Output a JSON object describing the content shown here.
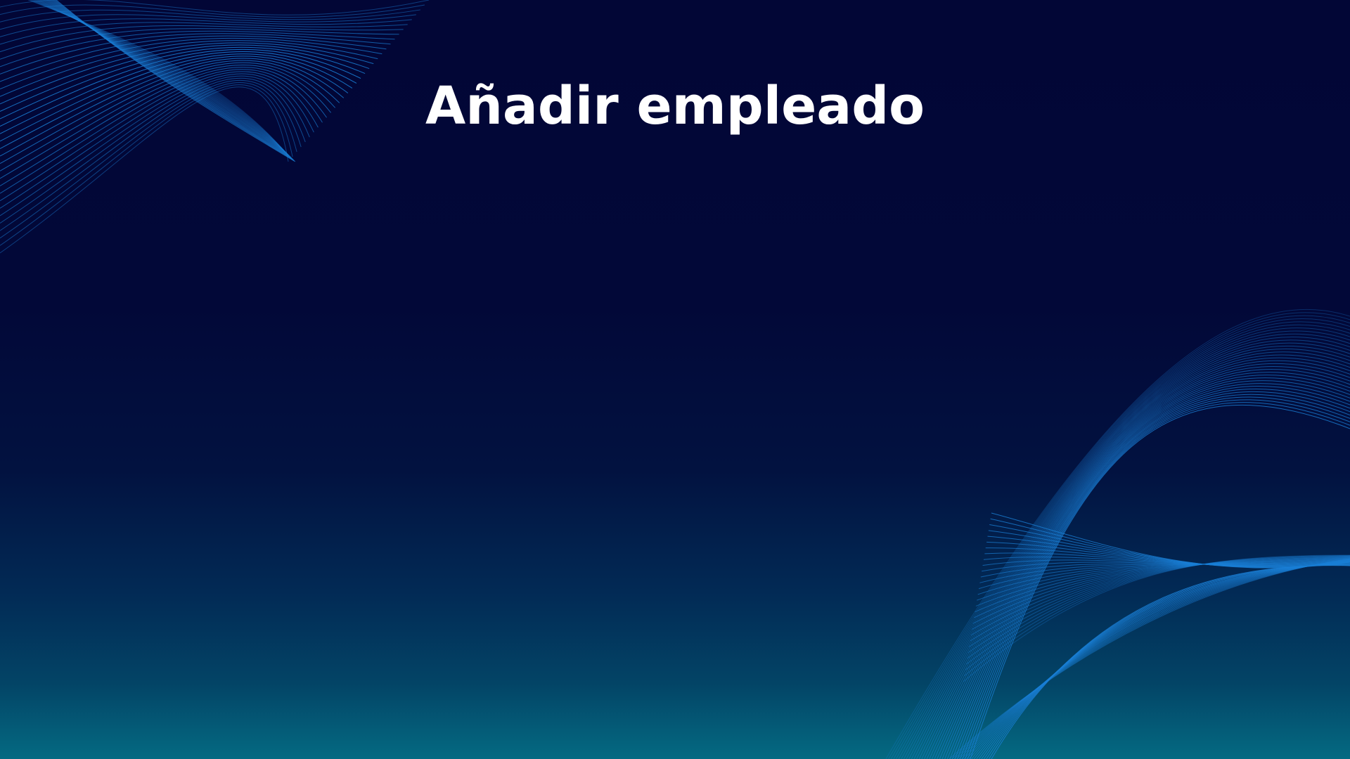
{
  "slide": {
    "title": "Añadir empleado"
  },
  "colors": {
    "background_top": "#020636",
    "background_bottom": "#046a82",
    "wave_lines": "#1a7fd6",
    "title_text": "#ffffff"
  },
  "decorations": {
    "top_left": "wave-lines-decoration",
    "bottom_right": "wave-lines-decoration"
  }
}
